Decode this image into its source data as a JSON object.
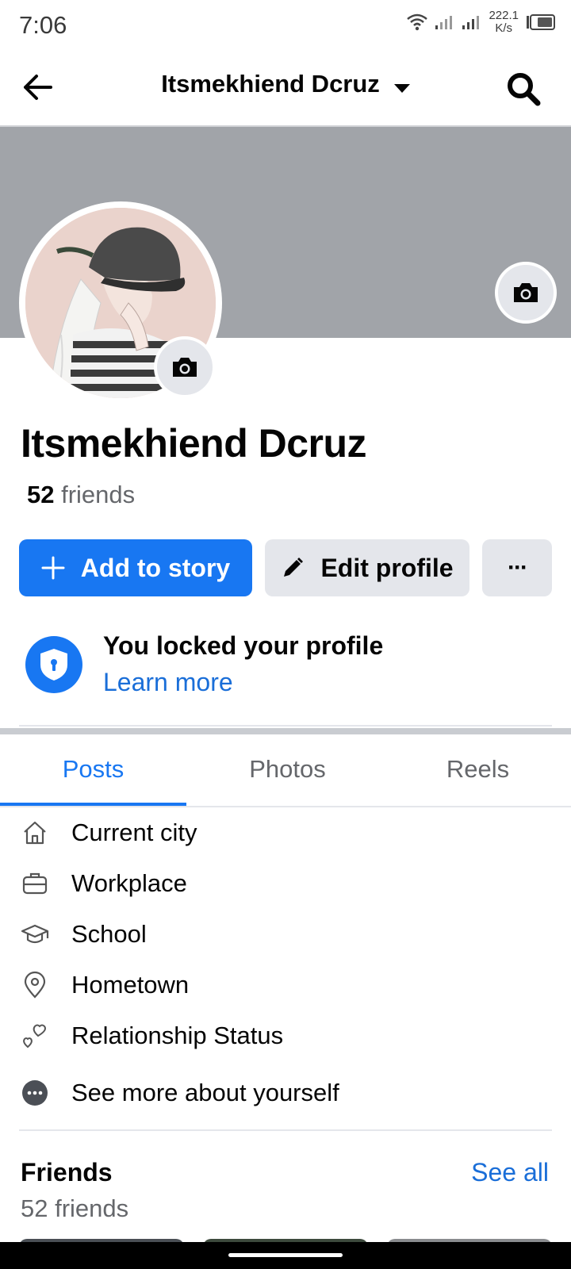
{
  "status_bar": {
    "time": "7:06",
    "speed_value": "222.1",
    "speed_unit": "K/s"
  },
  "header": {
    "title": "Itsmekhiend Dcruz"
  },
  "profile": {
    "name": "Itsmekhiend Dcruz",
    "friend_count": "52",
    "friends_word": "friends"
  },
  "actions": {
    "add_story": "Add to story",
    "edit_profile": "Edit profile",
    "more": "···"
  },
  "lock_notice": {
    "title": "You locked your profile",
    "link": "Learn more"
  },
  "tabs": [
    {
      "label": "Posts"
    },
    {
      "label": "Photos"
    },
    {
      "label": "Reels"
    }
  ],
  "details": [
    {
      "label": "Current city",
      "icon": "home-icon"
    },
    {
      "label": "Workplace",
      "icon": "briefcase-icon"
    },
    {
      "label": "School",
      "icon": "graduation-cap-icon"
    },
    {
      "label": "Hometown",
      "icon": "location-pin-icon"
    },
    {
      "label": "Relationship Status",
      "icon": "hearts-icon"
    },
    {
      "label": "See more about yourself",
      "icon": "more-dots-icon"
    }
  ],
  "friends": {
    "title": "Friends",
    "see_all": "See all",
    "subtitle": "52 friends"
  },
  "colors": {
    "accent": "#1877f2",
    "cover": "#a1a4a9",
    "button_gray": "#e4e6eb",
    "secondary_text": "#65676b"
  }
}
